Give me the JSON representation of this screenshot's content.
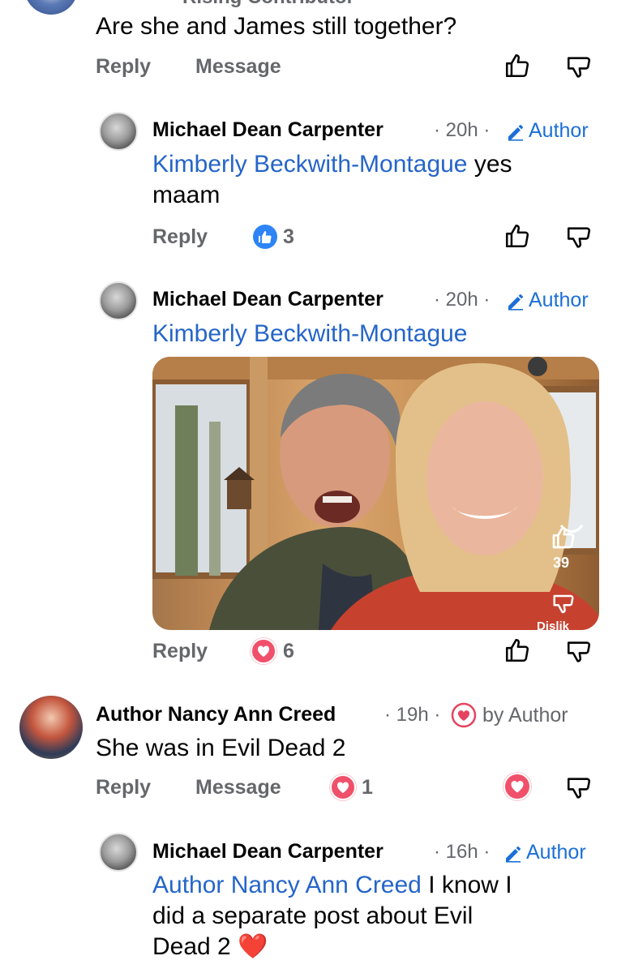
{
  "top_comment": {
    "badge_partial": "Rising Contributor",
    "text": "Are she and James still together?",
    "reply_label": "Reply",
    "message_label": "Message"
  },
  "reply1": {
    "name": "Michael Dean Carpenter",
    "time": "· 20h ·",
    "author_label": "Author",
    "mention": "Kimberly Beckwith-Montague",
    "text_line1_rest": " yes",
    "text_line2": "maam",
    "reply_label": "Reply",
    "reaction_count": "3"
  },
  "reply2": {
    "name": "Michael Dean Carpenter",
    "time": "· 20h ·",
    "author_label": "Author",
    "mention": "Kimberly Beckwith-Montague",
    "photo_like_count": "39",
    "photo_dislike_partial": "Dislik",
    "reply_label": "Reply",
    "reaction_count": "6"
  },
  "comment2": {
    "name": "Author Nancy Ann Creed",
    "time": "· 19h ·",
    "by_author_label": "by Author",
    "text": "She was in Evil Dead 2",
    "reply_label": "Reply",
    "message_label": "Message",
    "reaction_count": "1"
  },
  "reply3": {
    "name": "Michael Dean Carpenter",
    "time": "· 16h ·",
    "author_label": "Author",
    "mention": "Author Nancy Ann Creed",
    "text_line1_rest": " I know I",
    "text_line2": "did a separate post about Evil",
    "text_line3": "Dead 2",
    "emoji": "❤️"
  },
  "colors": {
    "link_blue": "#2565c9",
    "meta_gray": "#65676b",
    "like_blue": "#2d84f5",
    "heart_red": "#f0506a"
  },
  "icons": [
    "thumbs-up-icon",
    "thumbs-down-icon",
    "pencil-icon",
    "heart-icon",
    "like-reaction-icon"
  ]
}
